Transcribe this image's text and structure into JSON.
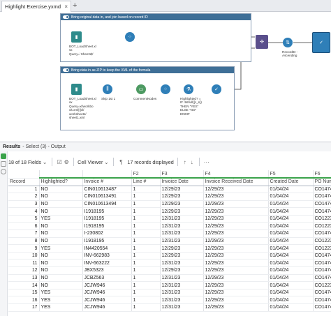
{
  "tab": {
    "title": "Highlight Exercise.yxmd",
    "close_glyph": "×",
    "add_glyph": "+"
  },
  "workflow": {
    "container1": {
      "title": "Bring original data in, and join based on record ID"
    },
    "container2": {
      "title": "Bring data in as ZIP to keep the XML of the formula"
    },
    "labels": {
      "input1": "BOT_LoadSheet.xl\nsx\nQuery=`Sheet1$`",
      "input2": "BOT_LoadSheet.xl\nsx\nQuery=xl/workbo\nok.xml|||xl/\nworksheets/\nsheet1.xml",
      "skip": "Skip 1st 1",
      "comment": "CommentNodes",
      "formula": "Highlighted? =\nIF !IsNull([c_s])\nTHEN \"YES\"\nELSE \"NO\"\nENDIF",
      "sort": "RecordID -\nAscending"
    }
  },
  "results": {
    "title": "Results",
    "subtitle": "- Select (3) - Output",
    "fields_selector": "18 of 18 Fields",
    "viewer": "Cell Viewer",
    "records_displayed": "17 records displayed",
    "columns": {
      "ids": [
        "",
        "",
        "F2",
        "F3",
        "F4",
        "F5",
        "F6"
      ],
      "names": [
        "Record",
        "Highlighted?",
        "Invoice #",
        "Line #",
        "Invoice Date",
        "Invoice Received Date",
        "Created Date",
        "PO Num"
      ]
    },
    "rows": [
      [
        "1",
        "NO",
        "CIN010613487",
        "1",
        "12/29/23",
        "12/29/23",
        "01/04/24",
        "CO1474"
      ],
      [
        "2",
        "NO",
        "CIN010613491",
        "1",
        "12/29/23",
        "12/29/23",
        "01/04/24",
        "CO1474"
      ],
      [
        "3",
        "NO",
        "CIN010613494",
        "1",
        "12/29/23",
        "12/29/23",
        "01/04/24",
        "CO1474"
      ],
      [
        "4",
        "NO",
        "I1918195",
        "1",
        "12/29/23",
        "12/29/23",
        "01/04/24",
        "CO1474"
      ],
      [
        "5",
        "YES",
        "I1918195",
        "1",
        "12/31/23",
        "12/29/23",
        "01/04/24",
        "CO1223"
      ],
      [
        "6",
        "NO",
        "I1918195",
        "1",
        "12/31/23",
        "12/29/23",
        "01/04/24",
        "CO1223"
      ],
      [
        "7",
        "NO",
        "I-230802",
        "1",
        "12/31/23",
        "12/29/23",
        "01/04/24",
        "CO1474"
      ],
      [
        "8",
        "NO",
        "I1918195",
        "1",
        "12/31/23",
        "12/29/23",
        "01/04/24",
        "CO1223"
      ],
      [
        "9",
        "YES",
        "IN4420554",
        "1",
        "12/29/23",
        "12/29/23",
        "01/04/24",
        "CO1223"
      ],
      [
        "10",
        "NO",
        "INV-662983",
        "1",
        "12/29/23",
        "12/29/23",
        "01/04/24",
        "CO1474"
      ],
      [
        "11",
        "NO",
        "INV-663222",
        "1",
        "12/31/23",
        "12/29/23",
        "01/04/24",
        "CO1474"
      ],
      [
        "12",
        "NO",
        "JBX5323",
        "1",
        "12/29/23",
        "12/29/23",
        "01/04/24",
        "CO1474"
      ],
      [
        "13",
        "NO",
        "JCBZ563",
        "1",
        "12/31/23",
        "12/29/23",
        "01/04/24",
        "CO1474"
      ],
      [
        "14",
        "NO",
        "JCJW946",
        "1",
        "12/31/23",
        "12/29/23",
        "01/04/24",
        "CO1223"
      ],
      [
        "15",
        "YES",
        "JCJW946",
        "1",
        "12/31/23",
        "12/29/23",
        "01/04/24",
        "CO1474"
      ],
      [
        "16",
        "YES",
        "JCJW946",
        "1",
        "12/31/23",
        "12/29/23",
        "01/04/24",
        "CO1474"
      ],
      [
        "17",
        "YES",
        "JCJW946",
        "1",
        "12/31/23",
        "12/29/23",
        "01/04/24",
        "CO1474"
      ]
    ]
  },
  "colors": {
    "container_header": "#3f6f97",
    "input_tool": "#2e8b8b",
    "join_tool": "#5a4f8c",
    "formula_tool": "#2f7fb8",
    "green_header": "#3aa34a"
  }
}
